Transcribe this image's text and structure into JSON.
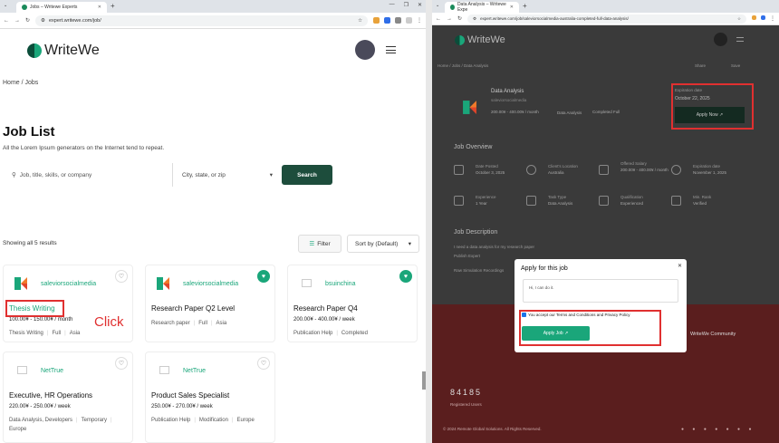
{
  "left": {
    "tab_title": "Jobs – Writewe Experts",
    "url": "expert.writewe.com/job/",
    "brand": "WriteWe",
    "breadcrumb": "Home / Jobs",
    "page_title": "Job List",
    "page_subtitle": "All the Lorem Ipsum generators on the Internet tend to repeat.",
    "search": {
      "keyword_placeholder": "Job, title, skills, or company",
      "location_placeholder": "City, state, or zip",
      "button": "Search"
    },
    "results_text": "Showing all 5 results",
    "filter_label": "Filter",
    "sort_label": "Sort by (Default)",
    "click_annotation": "Click",
    "cards": [
      {
        "company": "saleviorsocialmedia",
        "title": "Thesis Writing",
        "salary": "100.00¥ - 150.00¥ / month",
        "tags": [
          "Thesis Writing",
          "Full",
          "Asia"
        ],
        "favorited": false
      },
      {
        "company": "saleviorsocialmedia",
        "title": "Research Paper Q2 Level",
        "salary": "",
        "tags": [
          "Research paper",
          "Full",
          "Asia"
        ],
        "favorited": true
      },
      {
        "company": "bsuinchina",
        "title": "Research Paper Q4",
        "salary": "200.00¥ - 400.00¥ / week",
        "tags": [
          "Publication Help",
          "Completed"
        ],
        "favorited": true
      },
      {
        "company": "NetTrue",
        "title": "Executive, HR Operations",
        "salary": "220.00¥ - 250.00¥ / week",
        "tags": [
          "Data Analysis, Developers",
          "Temporary",
          "Europe"
        ],
        "favorited": false
      },
      {
        "company": "NetTrue",
        "title": "Product Sales Specialist",
        "salary": "250.00¥ - 270.00¥ / week",
        "tags": [
          "Publication Help",
          "Modification",
          "Europe"
        ],
        "favorited": false
      }
    ]
  },
  "right": {
    "tab_title": "Data Analysis – Writewe Expe",
    "url": "expert.writewe.com/job/saleviorsocialmedia-australia-completed-full-data-analysis/",
    "brand": "WriteWe",
    "breadcrumb": "Home / Jobs / Data Analysis",
    "share": "Share",
    "save": "Save",
    "job_title": "Data Analysis",
    "job_company": "saleviorsocialmedia",
    "job_salary": "200.00¥ - 400.00¥ / month",
    "job_type": "Data Analysis",
    "job_mode": "Completed Full",
    "expire_label": "Expiration date",
    "expire_date": "October 22, 2025",
    "apply_now": "Apply Now ↗",
    "overview_title": "Job Overview",
    "overview": [
      {
        "label": "Date Posted",
        "value": "October 3, 2025"
      },
      {
        "label": "Client's Location",
        "value": "Australia"
      },
      {
        "label": "Offered Salary",
        "value": "200.00¥ - 400.00¥ / month"
      },
      {
        "label": "Expiration date",
        "value": "November 1, 2025"
      },
      {
        "label": "Experience",
        "value": "1 Year"
      },
      {
        "label": "Task Type",
        "value": "Data Analysis"
      },
      {
        "label": "Qualification",
        "value": "Experienced"
      },
      {
        "label": "Min. Rank",
        "value": "Verified"
      }
    ],
    "description_title": "Job Description",
    "description_lines": [
      "I need a data analysis for my research paper",
      "Publish Expert",
      "Raw Simulation Recordings"
    ],
    "footer_heading": "WriteWe Community",
    "footer_count": "84185",
    "footer_count_label": "Registered Users",
    "footer_copyright": "© 2024 Remote Global Solutions. All Rights Reserved.",
    "modal": {
      "title": "Apply for this job",
      "message": "Hi, I can do it.",
      "consent": "You accept our Terms and Conditions and Privacy Policy",
      "submit": "Apply Job ↗"
    }
  }
}
